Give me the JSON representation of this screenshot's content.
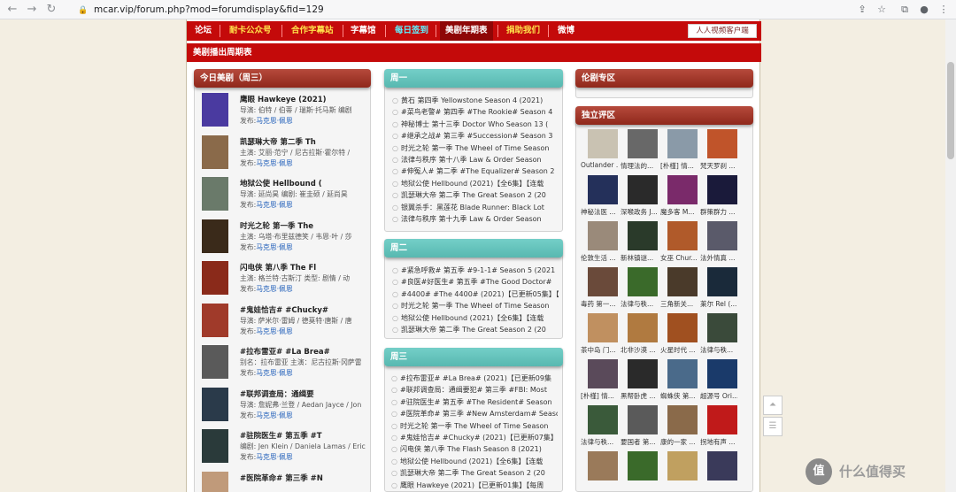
{
  "browser": {
    "url": "mcar.vip/forum.php?mod=forumdisplay&fid=129",
    "back_icon": "←",
    "forward_icon": "→",
    "reload_icon": "↻",
    "lock_icon": "🔒",
    "share_icon": "⇪",
    "star_icon": "☆",
    "ext_icon": "⧉",
    "profile_icon": "●",
    "menu_icon": "⋮"
  },
  "topnav": {
    "items": [
      "论坛",
      "耐卡公众号",
      "合作字幕站",
      "字幕馆",
      "每日签到",
      "美剧年期表",
      "捐助我们",
      "微博"
    ],
    "app_label": "人人视频客户端"
  },
  "section_title": "美剧播出周期表",
  "today": {
    "title": "今日美剧（周三）",
    "items": [
      {
        "title": "鹰眼 Hawkeye (2021)",
        "line1": "导演: 伯特 / 伯蒂 / 瑞斯·托马斯 编剧",
        "pub_prefix": "发布:",
        "pub": "马克思·佩恩"
      },
      {
        "title": "凯瑟琳大帝 第二季 Th",
        "line1": "主演: 艾丽·范宁 / 尼古拉斯·霍尔特 /",
        "pub_prefix": "发布:",
        "pub": "马克思·佩恩"
      },
      {
        "title": "地狱公使 Hellbound (",
        "line1": "导演: 延尚昊 编剧: 崔圭硕 / 延尚昊",
        "pub_prefix": "发布:",
        "pub": "马克思·佩恩"
      },
      {
        "title": "时光之轮 第一季 The",
        "line1": "主演: 乌塔·布里兹德笑 / 韦恩·叶 / 莎",
        "pub_prefix": "发布:",
        "pub": "马克思·佩恩"
      },
      {
        "title": "闪电侠 第八季 The Fl",
        "line1": "主演: 格兰特·古斯汀 类型: 剧情 / 动",
        "pub_prefix": "发布:",
        "pub": "马克思·佩恩"
      },
      {
        "title": "#鬼娃恰吉# #Chucky#",
        "line1": "导演: 萨米尔·雷姆 / 德莫特·唐斯 / 唐",
        "pub_prefix": "发布:",
        "pub": "马克思·佩恩"
      },
      {
        "title": "#拉布雷亚# #La Brea#",
        "line1": "别名：拉布雷亚 主演：尼古拉斯·冈萨雷",
        "pub_prefix": "发布:",
        "pub": "马克思·佩恩"
      },
      {
        "title": "#联邦调查局：通缉要",
        "line1": "导演: 詹妮弗·兰登 / Aedan Jayce / Jon",
        "pub_prefix": "发布:",
        "pub": "马克思·佩恩"
      },
      {
        "title": "#驻院医生# 第五季 #T",
        "line1": "编剧: Jen Klein / Daniela Lamas / Eric",
        "pub_prefix": "发布:",
        "pub": "马克思·佩恩"
      },
      {
        "title": "#医院革命# 第三季 #N",
        "line1": "",
        "pub_prefix": "",
        "pub": ""
      }
    ]
  },
  "days": [
    {
      "title": "周一",
      "items": [
        "黄石 第四季 Yellowstone Season 4 (2021)",
        "#菜鸟老警# 第四季 #The Rookie# Season 4",
        "神秘博士 第十三季 Doctor Who Season 13 (",
        "#继承之战# 第三季 #Succession# Season 3",
        "时光之轮 第一季 The Wheel of Time Season",
        "法律与秩序 第十八季 Law & Order Season",
        "#伸冤人# 第二季 #The Equalizer# Season 2",
        "地狱公使 Hellbound (2021)【全6集】【连载",
        "凯瑟琳大帝 第二季 The Great Season 2 (20",
        "银翼杀手：黑莲花 Blade Runner: Black Lot",
        "法律与秩序 第十九季 Law & Order Season"
      ]
    },
    {
      "title": "周二",
      "items": [
        "#紧急呼救# 第五季 #9-1-1# Season 5 (2021",
        "#良医#好医生# 第五季 #The Good Doctor#",
        "#4400# #The 4400# (2021)【已更新05集】【",
        "时光之轮 第一季 The Wheel of Time Season",
        "地狱公使 Hellbound (2021)【全6集】【连载",
        "凯瑟琳大帝 第二季 The Great Season 2 (20"
      ]
    },
    {
      "title": "周三",
      "items": [
        "#拉布雷亚# #La Brea# (2021)【已更新09集",
        "#联邦调查局：通缉要犯# 第三季 #FBI: Most",
        "#驻院医生# 第五季 #The Resident# Season",
        "#医院革命# 第三季 #New Amsterdam# Season",
        "时光之轮 第一季 The Wheel of Time Season",
        "#鬼娃恰吉# #Chucky# (2021)【已更新07集】",
        "闪电侠 第八季 The Flash Season 8 (2021)",
        "地狱公使 Hellbound (2021)【全6集】【连载",
        "凯瑟琳大帝 第二季 The Great Season 2 (20",
        "鹰眼 Hawkeye (2021)【已更新01集】【每周"
      ]
    }
  ],
  "lunju": {
    "title": "伦剧专区"
  },
  "independent": {
    "title": "独立评区",
    "captions": [
      "Outlander ...",
      "情理法的...",
      "[朴槿] 情...",
      "梵天罗刹 ...",
      "神秘法医 ...",
      "深喉政务 J...",
      "魔多客 M...",
      "群策群力 ...",
      "伦敦生活 ...",
      "新林镇谜...",
      "女巫 Chur...",
      "法外情真 ...",
      "毒药 第一...",
      "法律与秩...",
      "三角新关...",
      "莱尔 Rel (...",
      "茶中岛 门...",
      "北非沙漠 ...",
      "火星时代 ...",
      "法律与秩...",
      "[朴槿] 情...",
      "黑帮卧虎 ...",
      "蜘蛛侠 第...",
      "超源号 Ori...",
      "法律与秩...",
      "要国者 第...",
      "康的一家 ...",
      "拐地有声 ..."
    ],
    "poster_colors": [
      "#c9c2b2",
      "#686868",
      "#8a9aa8",
      "#c0542a",
      "#24305a",
      "#2a2a2a",
      "#7a2a6a",
      "#1a1a3a",
      "#9a8a7a",
      "#2a3a2a",
      "#b05a2a",
      "#5a5a6a",
      "#6a4a3a",
      "#3a6a2a",
      "#4a3a2a",
      "#1a2a3a",
      "#c09060",
      "#b07a40",
      "#a05020",
      "#3a4a3a",
      "#5a4a5a",
      "#2a2a2a",
      "#4a6a8a",
      "#1a3a6a",
      "#3a5a3a",
      "#5a5a5a",
      "#8a6a4a",
      "#c01a1a",
      "#9a7a5a",
      "#3a6a2a",
      "#c0a060",
      "#3a3a5a"
    ]
  },
  "today_poster_colors": [
    "#4a3aa0",
    "#8a6a4a",
    "#6a7a6a",
    "#3a2a1a",
    "#8a2a1a",
    "#a03a2a",
    "#5a5a5a",
    "#2a3a4a",
    "#2a3a3a",
    "#c09a7a"
  ],
  "float": {
    "top_icon": "⏶",
    "list_icon": "☰"
  },
  "watermark": {
    "logo": "值",
    "text": "什么值得买"
  }
}
